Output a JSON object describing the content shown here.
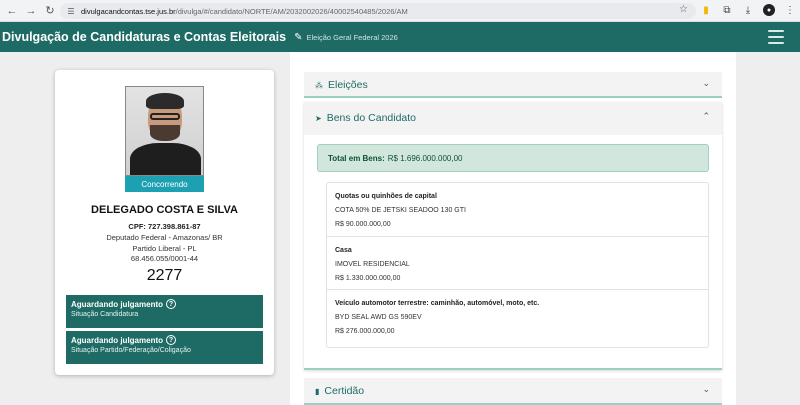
{
  "browser": {
    "url_host": "divulgacandcontas.tse.jus.br",
    "url_path": "/divulga/#/candidato/NORTE/AM/2032002026/40002540485/2026/AM"
  },
  "header": {
    "title": "Divulgação de Candidaturas e Contas Eleitorais",
    "subtitle": "Eleição Geral Federal 2026"
  },
  "candidate": {
    "status_badge": "Concorrendo",
    "name": "DELEGADO COSTA E SILVA",
    "cpf": "CPF: 727.398.861-87",
    "cargo": "Deputado Federal - Amazonas/ BR",
    "partido": "Partido Liberal - PL",
    "cnpj": "68.456.055/0001-44",
    "number": "2277",
    "status_candidatura": {
      "title": "Aguardando julgamento",
      "subtitle": "Situação Candidatura"
    },
    "status_partido": {
      "title": "Aguardando julgamento",
      "subtitle": "Situação Partido/Federação/Coligação"
    }
  },
  "sections": {
    "eleicoes": "Eleições",
    "bens": "Bens do Candidato",
    "certidao": "Certidão"
  },
  "bens": {
    "total_label": "Total em Bens:",
    "total_value": "R$ 1.696.000.000,00",
    "items": [
      {
        "type": "Quotas ou quinhões de capital",
        "description": "COTA 50% DE JETSKI SEADOO 130 GTI",
        "value": "R$ 90.000.000,00"
      },
      {
        "type": "Casa",
        "description": "IMOVEL RESIDENCIAL",
        "value": "R$ 1.330.000.000,00"
      },
      {
        "type": "Veículo automotor terrestre: caminhão, automóvel, moto, etc.",
        "description": "BYD SEAL AWD GS 590EV",
        "value": "R$ 276.000.000,00"
      }
    ]
  },
  "icons": {
    "back": "arrow-left-icon",
    "forward": "arrow-right-icon",
    "reload": "reload-icon",
    "site_info": "site-info-icon",
    "bookmark": "star-icon",
    "menu": "hamburger-icon"
  },
  "colors": {
    "header_bg": "#1e6b65",
    "accent_teal": "#1e6b65",
    "badge_blue": "#1ea0b3",
    "total_bg": "#d1e7dd"
  }
}
